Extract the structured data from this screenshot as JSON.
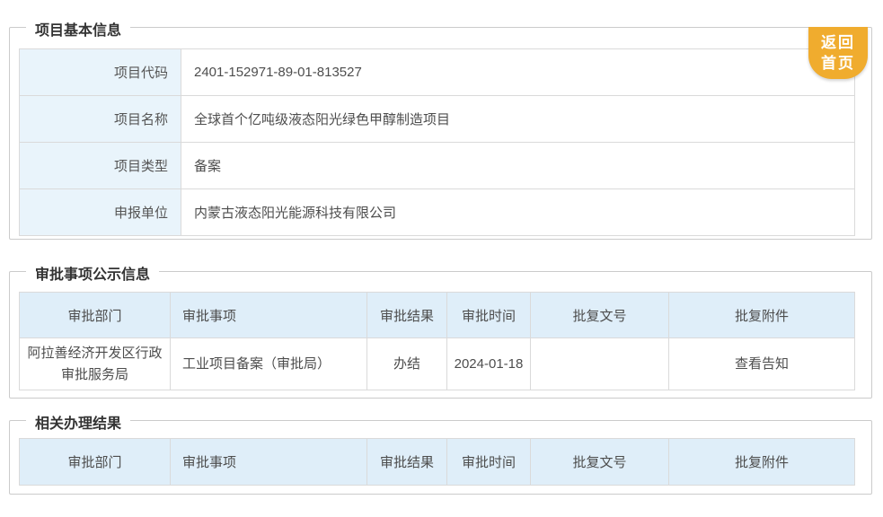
{
  "back_button": {
    "line1": "返回",
    "line2": "首页"
  },
  "colors": {
    "back_button_bg": "#f0ac2e",
    "table_header_bg": "#dfeef9",
    "label_cell_bg": "#e9f4fb",
    "panel_border": "#cbcbcb"
  },
  "sections": [
    {
      "title": "项目基本信息",
      "fields": [
        {
          "label": "项目代码",
          "value": "2401-152971-89-01-813527"
        },
        {
          "label": "项目名称",
          "value": "全球首个亿吨级液态阳光绿色甲醇制造项目"
        },
        {
          "label": "项目类型",
          "value": "备案"
        },
        {
          "label": "申报单位",
          "value": "内蒙古液态阳光能源科技有限公司"
        }
      ]
    },
    {
      "title": "审批事项公示信息",
      "headers": [
        "审批部门",
        "审批事项",
        "审批结果",
        "审批时间",
        "批复文号",
        "批复附件"
      ],
      "rows": [
        [
          "阿拉善经济开发区行政审批服务局",
          "工业项目备案（审批局）",
          "办结",
          "2024-01-18",
          "",
          "查看告知"
        ]
      ]
    },
    {
      "title": "相关办理结果",
      "headers": [
        "审批部门",
        "审批事项",
        "审批结果",
        "审批时间",
        "批复文号",
        "批复附件"
      ],
      "rows": []
    }
  ]
}
